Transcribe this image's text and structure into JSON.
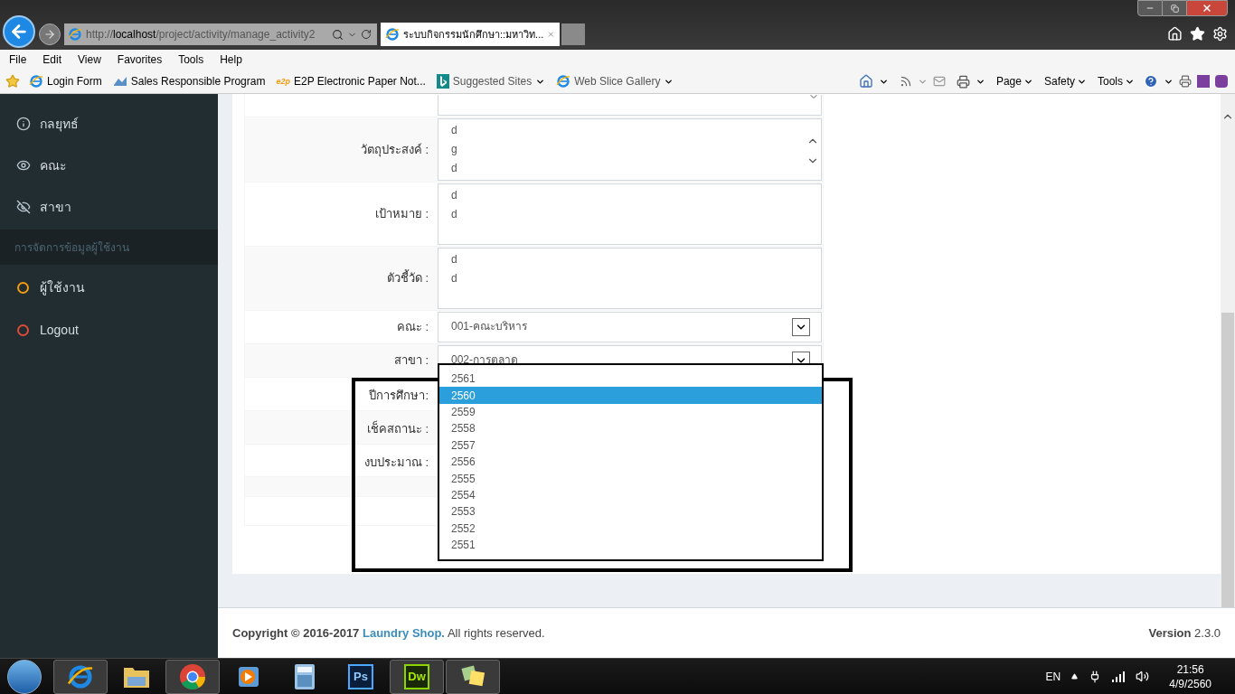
{
  "browser": {
    "address": {
      "scheme": "http://",
      "host": "localhost",
      "path": "/project/activity/manage_activity2"
    },
    "tab_title": "ระบบกิจกรรมนักศึกษา::มหาวิท...",
    "menu": [
      "File",
      "Edit",
      "View",
      "Favorites",
      "Tools",
      "Help"
    ],
    "favorites": [
      {
        "label": "Login Form",
        "kind": "page",
        "dropdown": false
      },
      {
        "label": "Sales Responsible Program",
        "kind": "app",
        "dropdown": false
      },
      {
        "label": "E2P  Electronic Paper Not...",
        "kind": "e2p",
        "badge": "e2p",
        "dropdown": false
      },
      {
        "label": "Suggested Sites",
        "kind": "bing",
        "dropdown": true
      },
      {
        "label": "Web Slice Gallery",
        "kind": "page",
        "dropdown": true
      }
    ],
    "commands": [
      "Page",
      "Safety",
      "Tools"
    ]
  },
  "sidebar": {
    "items": [
      {
        "label": "กลยุทธ์",
        "kind": "info"
      },
      {
        "label": "คณะ",
        "kind": "eye"
      },
      {
        "label": "สาขา",
        "kind": "eye-slash"
      }
    ],
    "section": "การจัดการข้อมูลผู้ใช้งาน",
    "user_items": [
      {
        "label": "ผู้ใช้งาน",
        "color": "#f39c12"
      },
      {
        "label": "Logout",
        "color": "#dd4b39"
      }
    ]
  },
  "form": {
    "rows": [
      {
        "kind": "partial"
      },
      {
        "label": "วัตถุประสงค์ :",
        "kind": "textarea",
        "value": "d\ng\nd",
        "scroll": true
      },
      {
        "label": "เป้าหมาย :",
        "kind": "textarea",
        "value": "d\nd",
        "scroll": false
      },
      {
        "label": "ตัวชี้วัด :",
        "kind": "textarea",
        "value": "d\nd",
        "scroll": false
      },
      {
        "label": "คณะ :",
        "kind": "select",
        "value": "001-คณะบริหาร"
      },
      {
        "label": "สาขา :",
        "kind": "select",
        "value": "002-การตลาด",
        "open": true
      },
      {
        "label": "ปีการศึกษา:",
        "kind": "covered"
      },
      {
        "label": "เช็คสถานะ :",
        "kind": "covered"
      },
      {
        "label": "งบประมาณ :",
        "kind": "covered"
      },
      {
        "kind": "blank"
      },
      {
        "kind": "blank"
      }
    ],
    "dropdown": {
      "options": [
        {
          "label": "2561",
          "selected": false
        },
        {
          "label": "2560",
          "selected": true
        },
        {
          "label": "2559",
          "selected": false
        },
        {
          "label": "2558",
          "selected": false
        },
        {
          "label": "2557",
          "selected": false
        },
        {
          "label": "2556",
          "selected": false
        },
        {
          "label": "2555",
          "selected": false
        },
        {
          "label": "2554",
          "selected": false
        },
        {
          "label": "2553",
          "selected": false
        },
        {
          "label": "2552",
          "selected": false
        },
        {
          "label": "2551",
          "selected": false
        }
      ]
    }
  },
  "footer": {
    "copyright": "Copyright © 2016-2017",
    "link": "Laundry Shop.",
    "rights": "All rights reserved.",
    "version_label": "Version",
    "version": "2.3.0"
  },
  "taskbar": {
    "apps": [
      {
        "kind": "ie",
        "active": true
      },
      {
        "kind": "folder",
        "active": false
      },
      {
        "kind": "chrome",
        "active": true
      },
      {
        "kind": "media",
        "active": false
      },
      {
        "kind": "calc",
        "active": false
      },
      {
        "kind": "ps",
        "badge": "Ps",
        "active": false
      },
      {
        "kind": "dw",
        "badge": "Dw",
        "active": true
      },
      {
        "kind": "notes",
        "active": true
      }
    ],
    "language": "EN",
    "time": "21:56",
    "date": "4/9/2560"
  }
}
